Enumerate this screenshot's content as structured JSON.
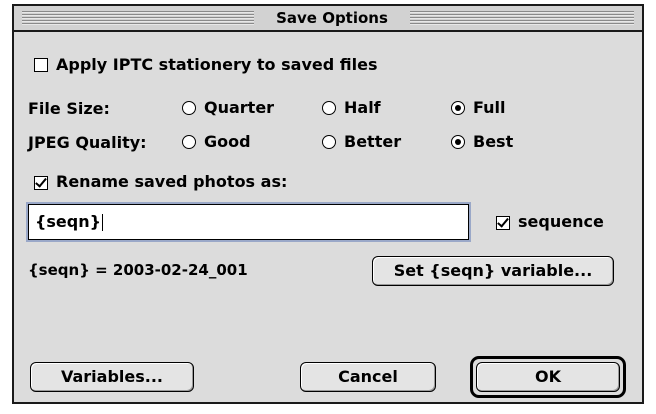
{
  "dialog": {
    "title": "Save Options",
    "apply_iptc": {
      "label": "Apply IPTC stationery to saved files",
      "checked": false
    },
    "file_size": {
      "label": "File Size:",
      "options": [
        "Quarter",
        "Half",
        "Full"
      ],
      "selected": "Full"
    },
    "jpeg_quality": {
      "label": "JPEG Quality:",
      "options": [
        "Good",
        "Better",
        "Best"
      ],
      "selected": "Best"
    },
    "rename": {
      "label": "Rename saved photos as:",
      "checked": true
    },
    "rename_value": "{seqn}",
    "sequence": {
      "label": "sequence",
      "checked": true
    },
    "seqn_readout": "{seqn} = 2003-02-24_001",
    "buttons": {
      "set_seqn": "Set {seqn} variable...",
      "variables": "Variables...",
      "cancel": "Cancel",
      "ok": "OK"
    }
  }
}
